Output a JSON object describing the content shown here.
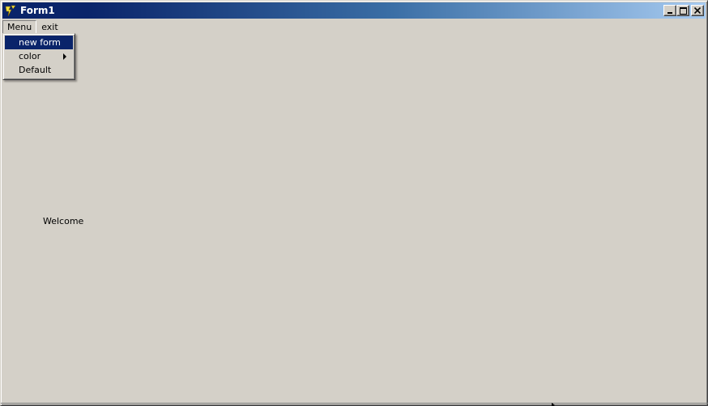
{
  "window": {
    "title": "Form1",
    "app_icon": "tcl-tk-feather-icon",
    "controls": [
      "minimize-icon",
      "maximize-icon",
      "close-icon"
    ]
  },
  "menubar": {
    "items": [
      {
        "label": "Menu",
        "active": true
      },
      {
        "label": "exit",
        "active": false
      }
    ]
  },
  "dropdown": {
    "items": [
      {
        "label": "new form",
        "selected": true,
        "has_submenu": false
      },
      {
        "label": "color",
        "selected": false,
        "has_submenu": true
      },
      {
        "label": "Default",
        "selected": false,
        "has_submenu": false
      }
    ]
  },
  "content": {
    "welcome_text": "Welcome"
  },
  "colors": {
    "titlebar_start": "#0a246a",
    "titlebar_end": "#a6caf0",
    "face": "#d4d0c8",
    "selection": "#0a246a"
  }
}
